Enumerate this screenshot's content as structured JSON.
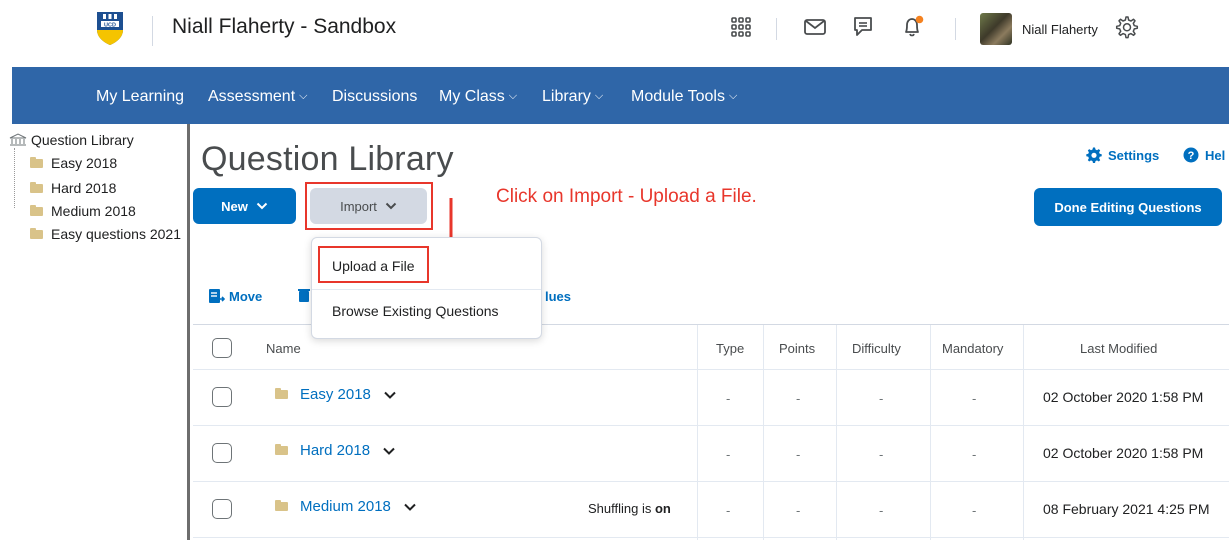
{
  "header": {
    "org_title": "Niall Flaherty - Sandbox",
    "user_name": "Niall Flaherty",
    "icons": [
      "app-grid-icon",
      "mail-icon",
      "chat-icon",
      "bell-icon",
      "gear-icon"
    ],
    "notification_dot_color": "#f58220"
  },
  "navbar": {
    "color": "#2f66a8",
    "items": [
      {
        "label": "My Learning",
        "has_menu": false
      },
      {
        "label": "Assessment",
        "has_menu": true
      },
      {
        "label": "Discussions",
        "has_menu": false
      },
      {
        "label": "My Class",
        "has_menu": true
      },
      {
        "label": "Library",
        "has_menu": true
      },
      {
        "label": "Module Tools",
        "has_menu": true
      }
    ]
  },
  "tree": {
    "root": "Question Library",
    "items": [
      "Easy 2018",
      "Hard 2018",
      "Medium 2018",
      "Easy questions 2021"
    ]
  },
  "page": {
    "title": "Question Library",
    "settings_label": "Settings",
    "help_label": "Hel",
    "new_label": "New",
    "import_label": "Import",
    "done_label": "Done Editing Questions",
    "annotation": "Click on Import - Upload a File."
  },
  "import_menu": {
    "items": [
      "Upload a File",
      "Browse Existing Questions"
    ]
  },
  "actions": {
    "move_label": "Move",
    "values_fragment": "lues"
  },
  "table": {
    "columns": [
      "Name",
      "Type",
      "Points",
      "Difficulty",
      "Mandatory",
      "Last Modified"
    ],
    "rows": [
      {
        "name": "Easy 2018",
        "type": "-",
        "points": "-",
        "difficulty": "-",
        "mandatory": "-",
        "modified": "02 October 2020 1:58 PM",
        "shuffling": ""
      },
      {
        "name": "Hard 2018",
        "type": "-",
        "points": "-",
        "difficulty": "-",
        "mandatory": "-",
        "modified": "02 October 2020 1:58 PM",
        "shuffling": ""
      },
      {
        "name": "Medium 2018",
        "type": "-",
        "points": "-",
        "difficulty": "-",
        "mandatory": "-",
        "modified": "08 February 2021 4:25 PM",
        "shuffling_prefix": "Shuffling is",
        "shuffling_state": "on"
      }
    ]
  },
  "colors": {
    "primary": "#006fbf",
    "annotation_red": "#e8362b"
  }
}
